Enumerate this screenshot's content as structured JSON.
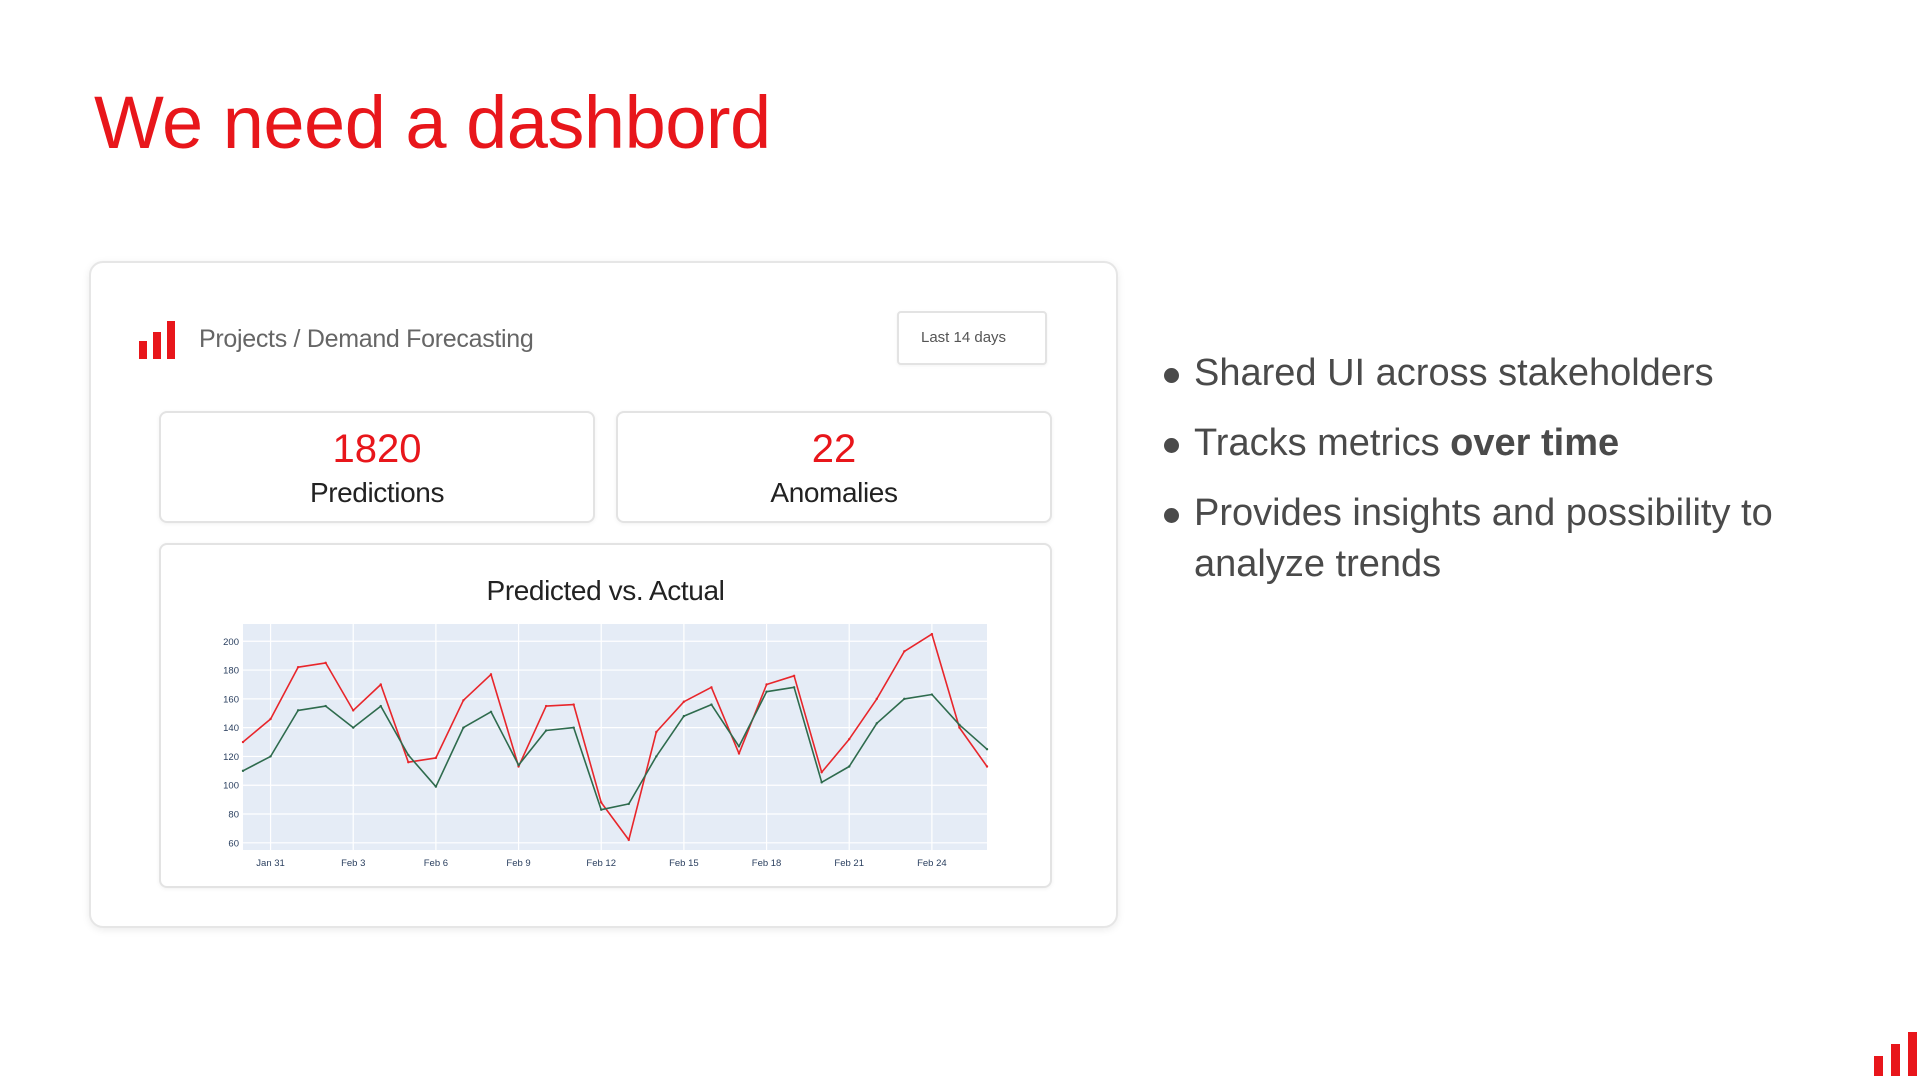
{
  "slide": {
    "title": "We need a dashbord",
    "accent_color": "#e8161b"
  },
  "dashboard": {
    "logo_icon": "bar-chart-icon",
    "breadcrumb": "Projects / Demand Forecasting",
    "date_range": "Last 14 days",
    "kpis": [
      {
        "value": "1820",
        "label": "Predictions"
      },
      {
        "value": "22",
        "label": "Anomalies"
      }
    ]
  },
  "bullets": [
    {
      "text": "Shared UI across stakeholders",
      "bold": ""
    },
    {
      "text": "Tracks metrics ",
      "bold": "over time"
    },
    {
      "text": "Provides insights and possibility to analyze trends",
      "bold": ""
    }
  ],
  "chart_data": {
    "type": "line",
    "title": "Predicted vs. Actual",
    "xlabel": "",
    "ylabel": "",
    "x_ticks": [
      "Jan 31",
      "Feb 3",
      "Feb 6",
      "Feb 9",
      "Feb 12",
      "Feb 15",
      "Feb 18",
      "Feb 21",
      "Feb 24"
    ],
    "y_ticks": [
      60,
      80,
      100,
      120,
      140,
      160,
      180,
      200
    ],
    "ylim": [
      55,
      212
    ],
    "grid": true,
    "plot_background": "#e5ecf6",
    "x": [
      "Jan 30",
      "Jan 31",
      "Feb 1",
      "Feb 2",
      "Feb 3",
      "Feb 4",
      "Feb 5",
      "Feb 6",
      "Feb 7",
      "Feb 8",
      "Feb 9",
      "Feb 10",
      "Feb 11",
      "Feb 12",
      "Feb 13",
      "Feb 14",
      "Feb 15",
      "Feb 16",
      "Feb 17",
      "Feb 18",
      "Feb 19",
      "Feb 20",
      "Feb 21",
      "Feb 22",
      "Feb 23",
      "Feb 24",
      "Feb 25",
      "Feb 26"
    ],
    "series": [
      {
        "color": "#e8262b",
        "values": [
          130,
          146,
          182,
          185,
          152,
          170,
          116,
          119,
          159,
          177,
          113,
          155,
          156,
          88,
          62,
          137,
          158,
          168,
          122,
          170,
          176,
          109,
          132,
          160,
          193,
          205,
          140,
          113
        ]
      },
      {
        "color": "#2e6b4d",
        "values": [
          110,
          120,
          152,
          155,
          140,
          155,
          121,
          99,
          140,
          151,
          114,
          138,
          140,
          83,
          87,
          120,
          148,
          156,
          127,
          165,
          168,
          102,
          113,
          143,
          160,
          163,
          142,
          125
        ]
      }
    ]
  }
}
